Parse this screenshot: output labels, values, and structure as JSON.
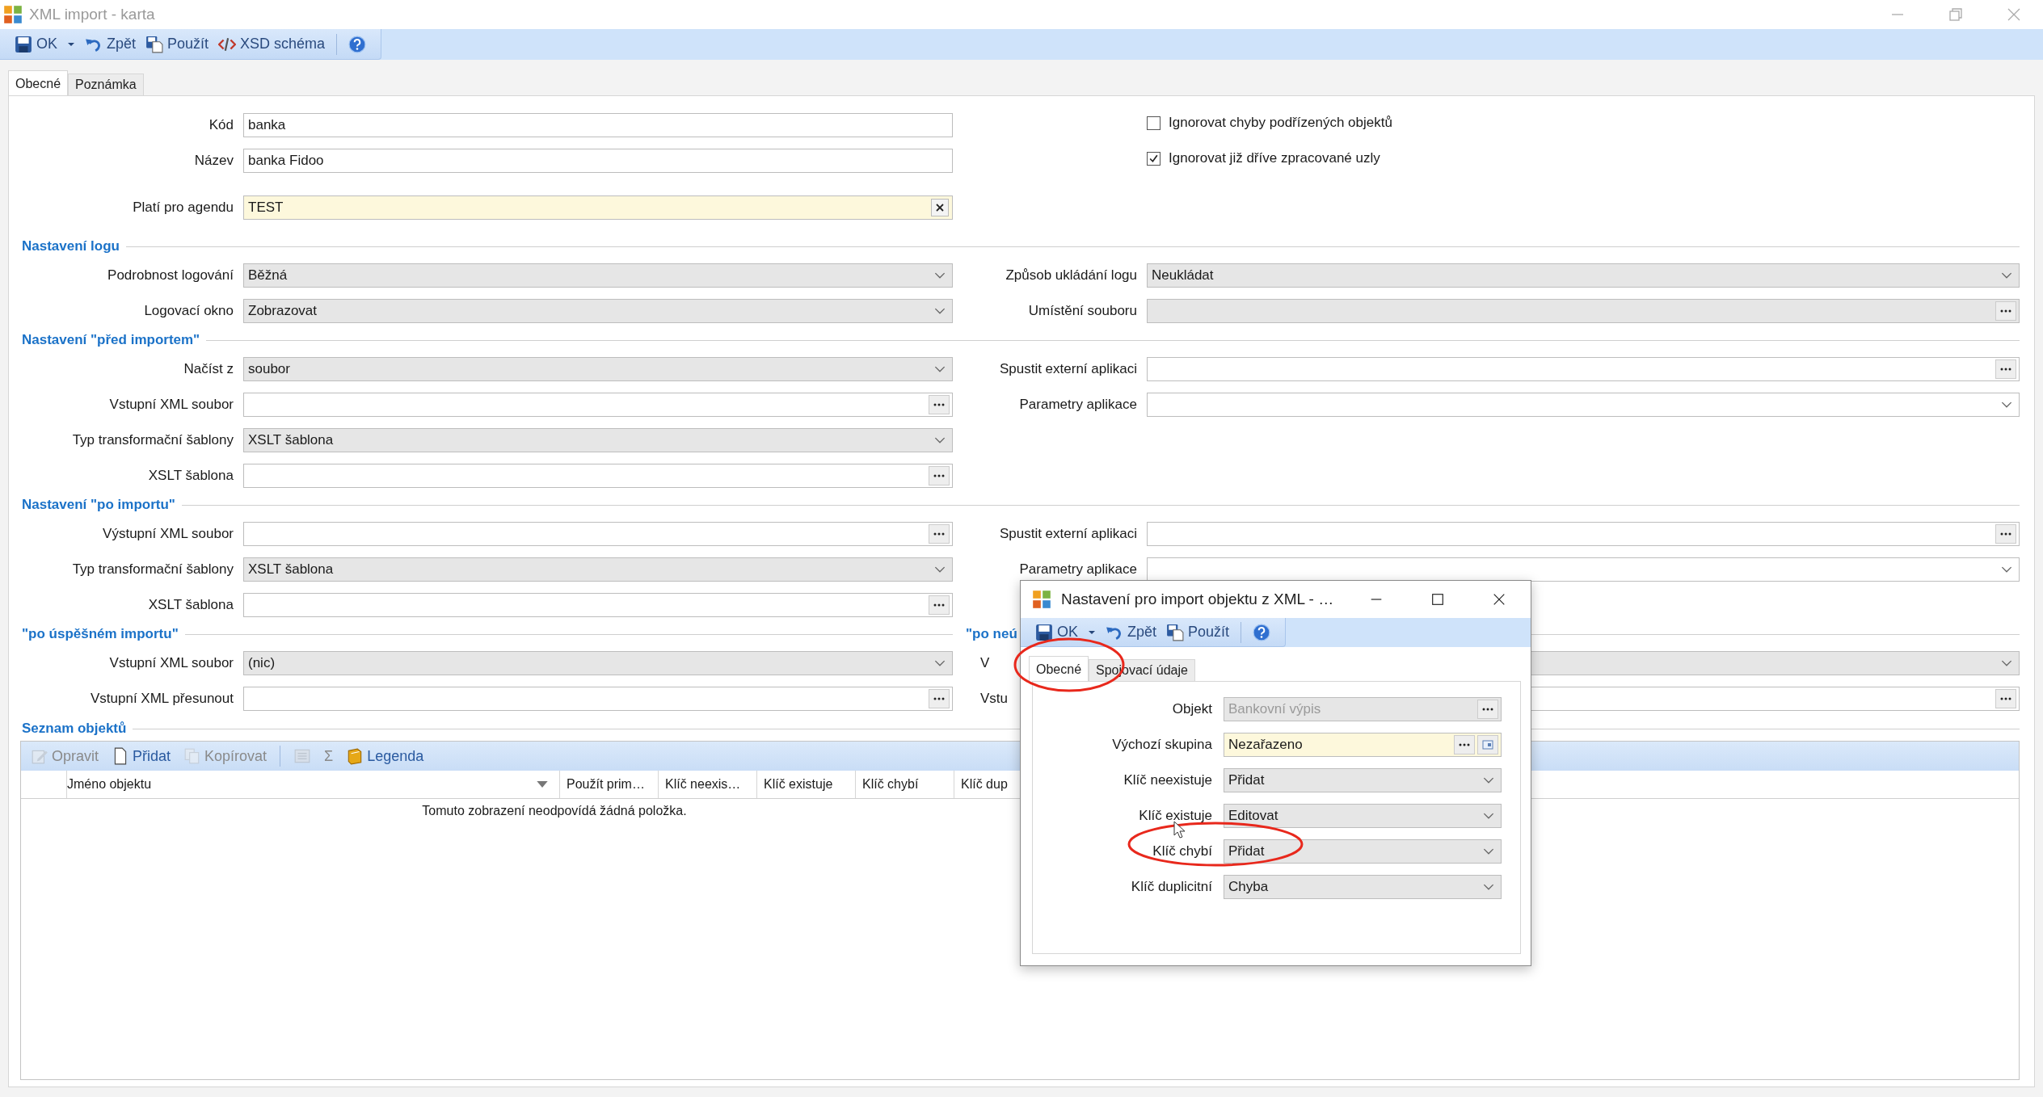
{
  "window": {
    "title": "XML import - karta"
  },
  "toolbar": [
    {
      "kind": "ok",
      "label": "OK"
    },
    {
      "kind": "caret"
    },
    {
      "kind": "undo",
      "label": "Zpět"
    },
    {
      "kind": "apply",
      "label": "Použít"
    },
    {
      "kind": "xsd",
      "label": "XSD schéma"
    },
    {
      "kind": "help"
    }
  ],
  "tabs": [
    {
      "label": "Obecné",
      "selected": true
    },
    {
      "label": "Poznámka",
      "selected": false
    }
  ],
  "header_fields": [
    {
      "label": "Kód",
      "value": "banka",
      "kind": "text"
    },
    {
      "label": "Název",
      "value": "banka Fidoo",
      "kind": "text"
    },
    {
      "label": "Platí pro agendu",
      "value": "TEST",
      "kind": "clearable"
    }
  ],
  "checkboxes": [
    {
      "label": "Ignorovat chyby podřízených objektů",
      "checked": false
    },
    {
      "label": "Ignorovat již dříve zpracované uzly",
      "checked": true
    }
  ],
  "sections": [
    {
      "title": "Nastavení logu",
      "rows": [
        [
          {
            "label": "Podrobnost logování",
            "value": "Běžná",
            "kind": "combo"
          },
          {
            "label": "Způsob ukládání logu",
            "value": "Neukládat",
            "kind": "combo"
          }
        ],
        [
          {
            "label": "Logovací okno",
            "value": "Zobrazovat",
            "kind": "combo"
          },
          {
            "label": "Umístění souboru",
            "kind": "disabled_browse"
          }
        ]
      ]
    },
    {
      "title": "Nastavení \"před importem\"",
      "rows": [
        [
          {
            "label": "Načíst z",
            "value": "soubor",
            "kind": "combo"
          },
          {
            "label": "Spustit externí aplikaci",
            "kind": "browse"
          }
        ],
        [
          {
            "label": "Vstupní XML soubor",
            "kind": "browse"
          },
          {
            "label": "Parametry aplikace",
            "kind": "combo_white"
          }
        ],
        [
          {
            "label": "Typ transformační šablony",
            "value": "XSLT šablona",
            "kind": "combo"
          },
          null
        ],
        [
          {
            "label": "XSLT šablona",
            "kind": "browse"
          },
          null
        ]
      ]
    },
    {
      "title": "Nastavení \"po importu\"",
      "rows": [
        [
          {
            "label": "Výstupní XML soubor",
            "kind": "browse"
          },
          {
            "label": "Spustit externí aplikaci",
            "kind": "browse"
          }
        ],
        [
          {
            "label": "Typ transformační šablony",
            "value": "XSLT šablona",
            "kind": "combo"
          },
          {
            "label": "Parametry aplikace",
            "kind": "combo_white"
          }
        ],
        [
          {
            "label": "XSLT šablona",
            "kind": "browse"
          },
          null
        ]
      ]
    },
    {
      "title": "\"po úspěšném importu\"",
      "right_title": "\"po neú",
      "rows": [
        [
          {
            "label": "Vstupní XML soubor",
            "value": "(nic)",
            "kind": "combo"
          },
          {
            "label": "V",
            "kind": "combo",
            "clipped": true
          }
        ],
        [
          {
            "label": "Vstupní XML přesunout",
            "kind": "browse"
          },
          {
            "label": "Vstu",
            "kind": "browse",
            "clipped": true
          }
        ]
      ]
    }
  ],
  "objects": {
    "title": "Seznam objektů",
    "toolbar": [
      {
        "kind": "edit",
        "label": "Opravit",
        "disabled": true
      },
      {
        "kind": "add",
        "label": "Přidat",
        "disabled": false
      },
      {
        "kind": "copy",
        "label": "Kopírovat",
        "disabled": true
      },
      {
        "kind": "export",
        "disabled": true
      },
      {
        "kind": "sum",
        "label": "Σ",
        "disabled": true
      },
      {
        "kind": "legend",
        "label": "Legenda",
        "disabled": false
      }
    ],
    "columns": [
      {
        "label": "Jméno objektu",
        "filter": true
      },
      {
        "label": "Použít prim…",
        "filter": false
      },
      {
        "label": "Klíč neexis…",
        "filter": false
      },
      {
        "label": "Klíč existuje",
        "filter": false
      },
      {
        "label": "Klíč chybí",
        "filter": false
      },
      {
        "label": "Klíč dup",
        "filter": false
      }
    ],
    "empty_message": "Tomuto zobrazení neodpovídá žádná položka."
  },
  "dialog": {
    "title": "Nastavení pro import objektu z XML - …",
    "toolbar": [
      {
        "kind": "ok",
        "label": "OK"
      },
      {
        "kind": "caret"
      },
      {
        "kind": "undo",
        "label": "Zpět"
      },
      {
        "kind": "apply",
        "label": "Použít"
      },
      {
        "kind": "help"
      }
    ],
    "tabs": [
      {
        "label": "Obecné",
        "selected": true
      },
      {
        "label": "Spojovací údaje",
        "selected": false
      }
    ],
    "fields": [
      {
        "label": "Objekt",
        "value": "Bankovní výpis",
        "kind": "disabled_browse"
      },
      {
        "label": "Výchozí skupina",
        "value": "Nezařazeno",
        "kind": "yellow_browse"
      },
      {
        "label": "Klíč neexistuje",
        "value": "Přidat",
        "kind": "combo"
      },
      {
        "label": "Klíč existuje",
        "value": "Editovat",
        "kind": "combo"
      },
      {
        "label": "Klíč chybí",
        "value": "Přidat",
        "kind": "combo"
      },
      {
        "label": "Klíč duplicitní",
        "value": "Chyba",
        "kind": "combo"
      }
    ]
  }
}
